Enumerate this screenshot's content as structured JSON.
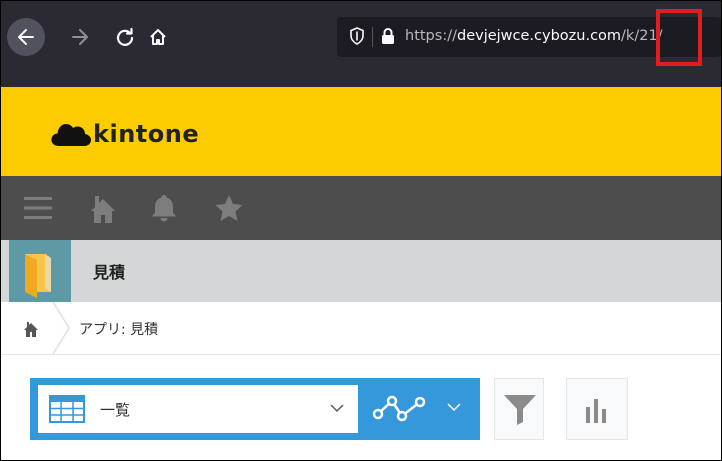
{
  "browser": {
    "url_scheme": "https://",
    "url_host": "devjejwce.cybozu.com",
    "url_path": "/k/21/",
    "icons": [
      "back-arrow-icon",
      "forward-arrow-icon",
      "reload-icon",
      "home-icon",
      "shield-icon",
      "lock-icon"
    ]
  },
  "highlight_color": "#e01e1e",
  "header": {
    "logo_text": "kintone",
    "brand_color": "#fccb00"
  },
  "global_nav": {
    "icons": [
      "menu-icon",
      "portal-home-icon",
      "bell-icon",
      "star-icon"
    ]
  },
  "app": {
    "title": "見積"
  },
  "breadcrumb": {
    "text": "アプリ: 見積"
  },
  "toolbar": {
    "view_label": "一覧",
    "accent_color": "#3498db",
    "icons": [
      "table-view-icon",
      "graph-icon",
      "filter-icon",
      "chart-icon"
    ]
  }
}
